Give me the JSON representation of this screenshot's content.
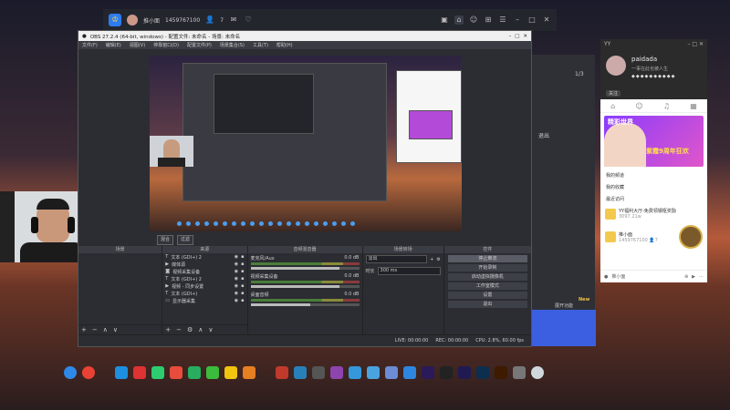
{
  "topbar": {
    "username": "推小面",
    "user_id": "1459767100",
    "count": "7"
  },
  "obs": {
    "title": "OBS 27.2.4 (64-bit, windows) - 配置文件: 未命名 - 场景: 未命名",
    "menu": [
      "文件(F)",
      "编辑(E)",
      "视图(V)",
      "停靠窗口(D)",
      "配置文件(P)",
      "场景集合(S)",
      "工具(T)",
      "帮助(H)"
    ],
    "mode_buttons": [
      "混合",
      "过滤"
    ],
    "docks": {
      "scenes": {
        "header": "场景"
      },
      "sources": {
        "header": "来源",
        "items": [
          "文本 (GDI+) 2",
          "媒体源",
          "视频采集设备",
          "文本 (GDI+) 2",
          "视频 - 同步设置",
          "文本 (GDI+)",
          "显示器采集"
        ]
      },
      "mixer": {
        "header": "音频混音器",
        "channels": [
          {
            "name": "麦克风/Aux",
            "db": "0.0 dB",
            "level": 0.82
          },
          {
            "name": "视频采集设备",
            "db": "0.0 dB",
            "level": 0.82
          },
          {
            "name": "桌面音频",
            "db": "0.0 dB",
            "level": 0.55
          }
        ]
      },
      "transitions": {
        "header": "场景转场",
        "type": "淡出",
        "duration_label": "时长",
        "duration": "300 ms"
      },
      "controls": {
        "header": "控件",
        "buttons": [
          "停止推流",
          "开始录制",
          "启动虚拟摄像机",
          "工作室模式",
          "设置",
          "退出"
        ]
      }
    },
    "status": {
      "live": "LIVE: 00:00:00",
      "rec": "REC: 00:00:00",
      "cpu": "CPU: 2.8%, 60.00 fps"
    }
  },
  "chat": {
    "app": "YY",
    "name": "paidada",
    "signature": "一事在此也被人生",
    "tag": "关注",
    "banner_title": "精彩世界",
    "banner_sub": "紫霞9周年狂欢",
    "links": [
      "我的频道",
      "我的收藏",
      "最近访问"
    ],
    "promo_title": "YY福利大厅-免费领钢枢奖励",
    "promo_sub": "3097.21w",
    "user_id": "1459767100",
    "user_count": "7",
    "bottom_label": "推小面",
    "host_name": "推小面",
    "host_id": "1459767100",
    "host_count": "7"
  },
  "side": {
    "items": [
      "1/3",
      "退出",
      "展开功能"
    ],
    "new_label": "New"
  },
  "taskbar": {
    "icons": [
      "edge-icon",
      "chrome-icon",
      "steam-like-icon",
      "app1-icon",
      "wechat-icon",
      "netease-icon",
      "play-icon",
      "iqiyi-icon",
      "avatar-icon",
      "app2-icon",
      "app3-icon",
      "app4-icon",
      "app5-icon",
      "app6-icon",
      "folder-icon",
      "paint-icon",
      "app7-icon",
      "app8-icon",
      "premiere-icon",
      "capcut-icon",
      "aftereffects-icon",
      "photoshop-icon",
      "illustrator-icon",
      "app9-icon",
      "recycle-icon"
    ],
    "colors": [
      "#2f89e8",
      "#e94235",
      "#1d8fe0",
      "#d33",
      "#2ecc71",
      "#e74c3c",
      "#27ae60",
      "#3cbc3c",
      "#f1c40f",
      "#e67e22",
      "#c0392b",
      "#2980b9",
      "#555",
      "#8e44ad",
      "#3498db",
      "#4aa3df",
      "#6c8cd5",
      "#2e86de",
      "#2b1a59",
      "#222",
      "#1f1a52",
      "#0d2f4f",
      "#3d1a00",
      "#777",
      "#cfd8dc"
    ]
  }
}
